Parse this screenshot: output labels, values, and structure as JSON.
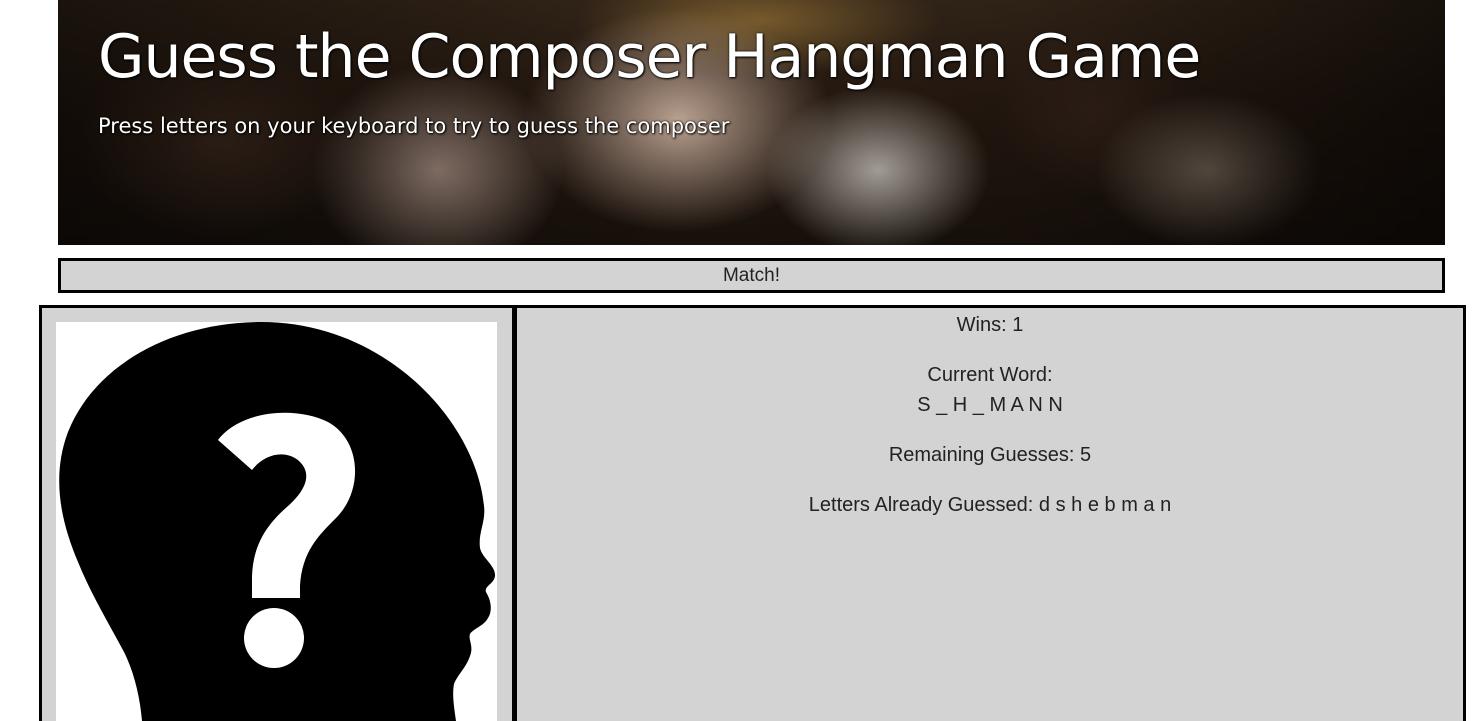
{
  "header": {
    "title": "Guess the Composer Hangman Game",
    "subtitle": "Press letters on your keyboard to try to guess the composer"
  },
  "status": {
    "message": "Match!"
  },
  "image_panel": {
    "icon": "question-head-silhouette-icon"
  },
  "stats": {
    "wins_label": "Wins:",
    "wins_value": "1",
    "current_word_label": "Current Word:",
    "current_word_value": "S _ H _ M A N N",
    "remaining_label": "Remaining Guesses:",
    "remaining_value": "5",
    "guessed_label": "Letters Already Guessed:",
    "guessed_value": "d s h e b m a n"
  },
  "colors": {
    "panel_bg": "#d3d3d3",
    "border": "#000000",
    "text": "#222222",
    "hero_text": "#ffffff"
  }
}
